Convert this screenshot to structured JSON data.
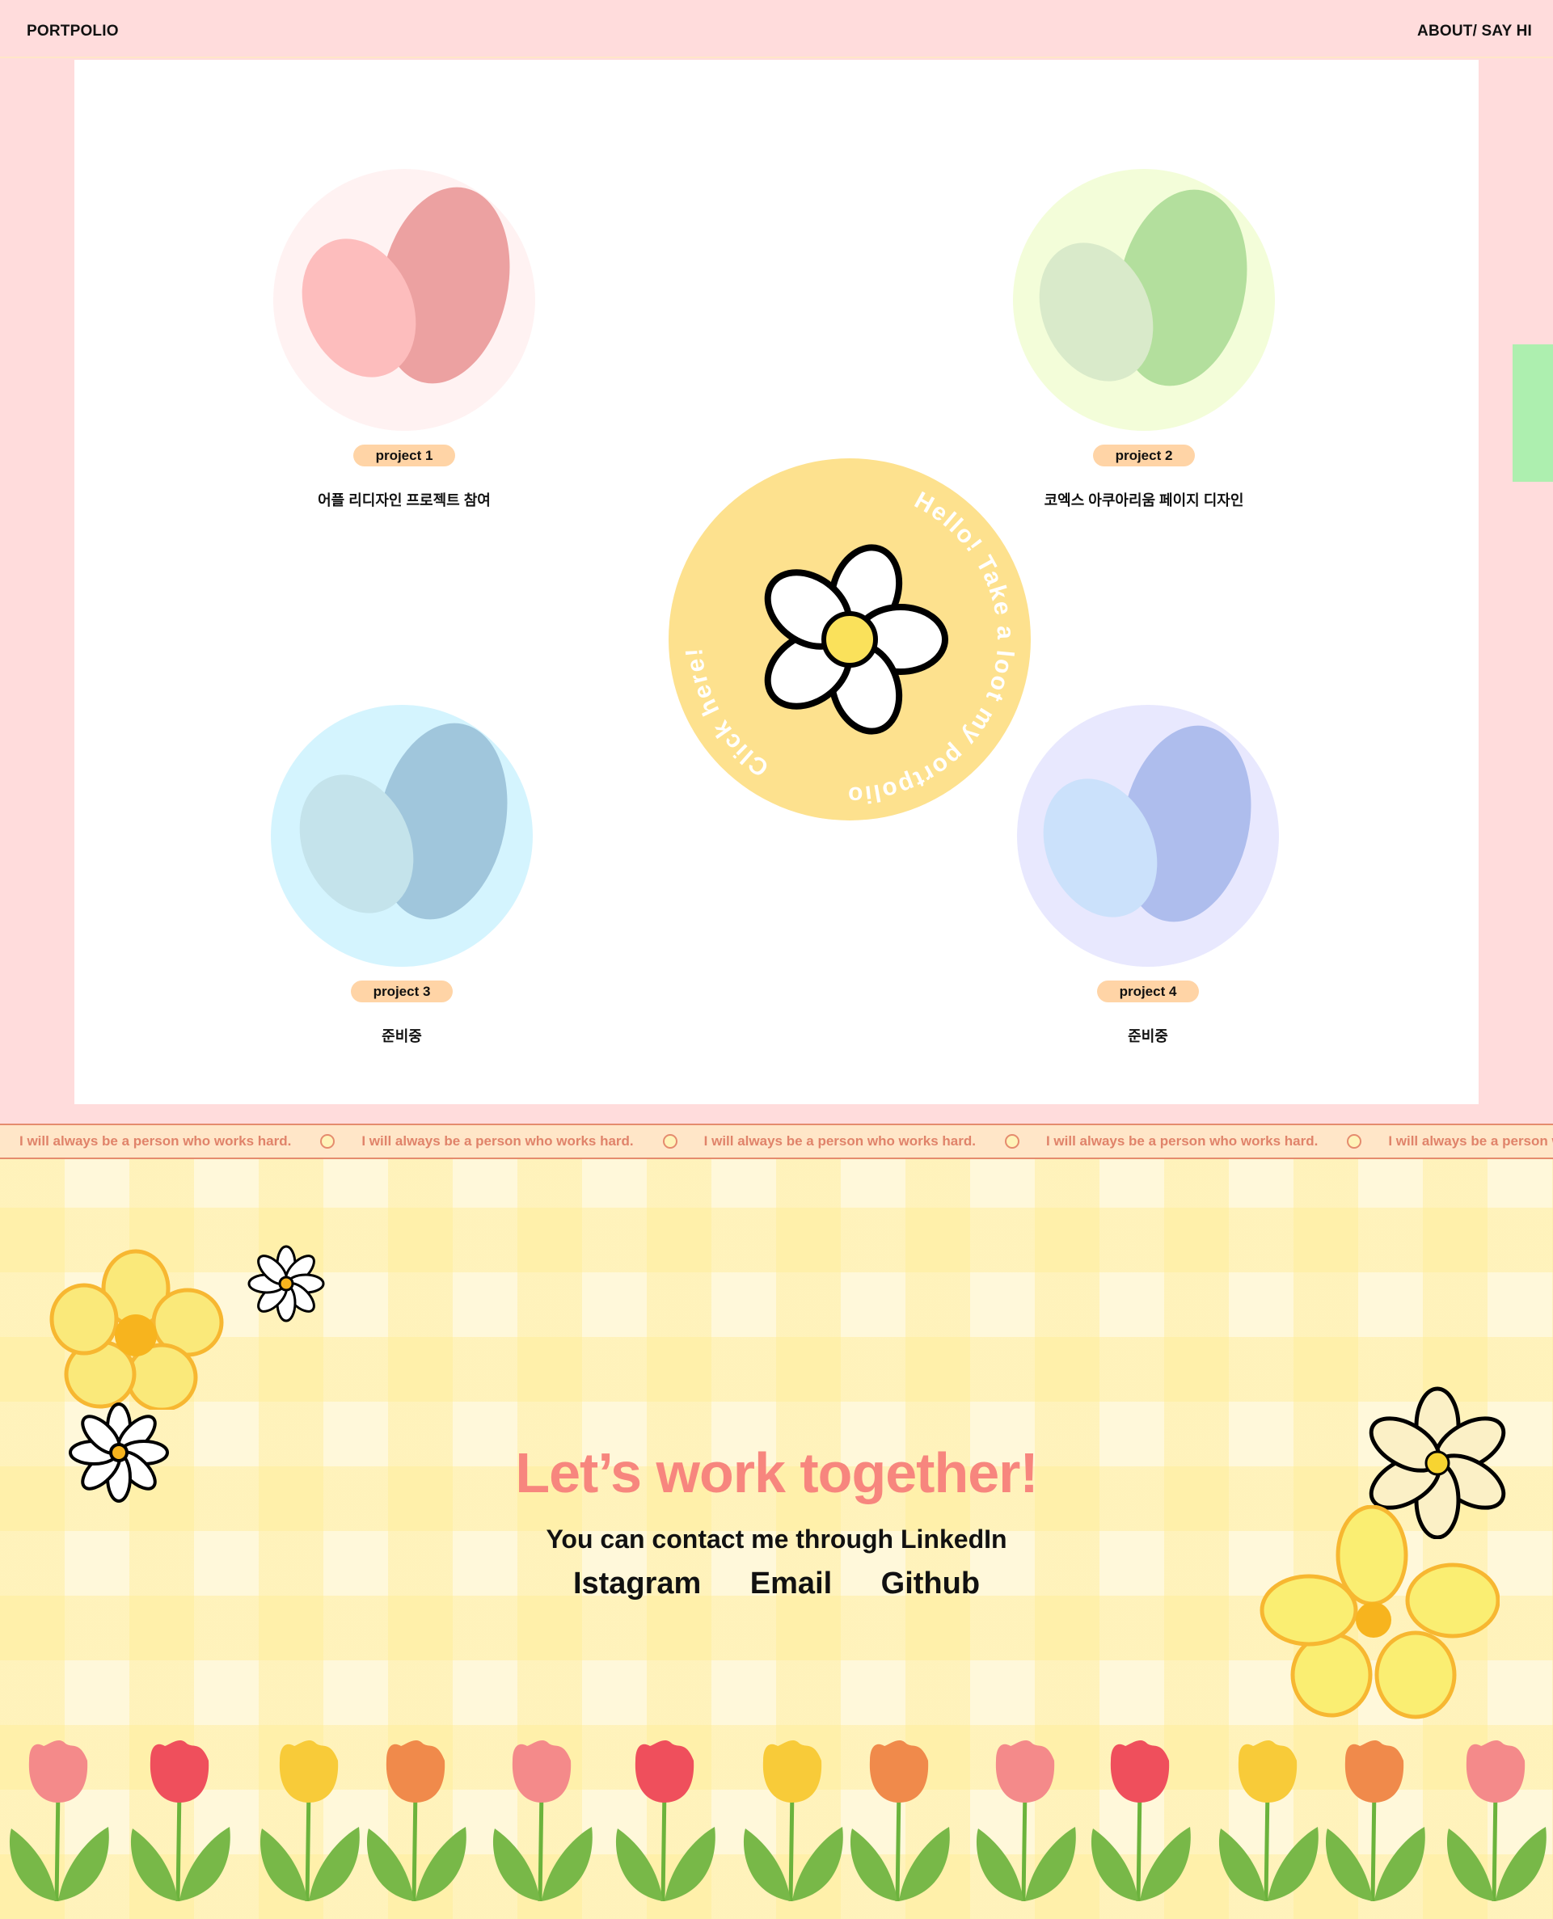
{
  "header": {
    "brand": "PORTPOLIO",
    "nav_right": "ABOUT/ SAY HI"
  },
  "projects": [
    {
      "label": "project 1",
      "desc": "어플 리디자인 프로젝트 참여",
      "colors": {
        "bg": "#FFF2F2",
        "big": "#ECA1A1",
        "small": "#FDBDBD"
      }
    },
    {
      "label": "project 2",
      "desc": "코엑스 아쿠아리움 페이지 디자인",
      "colors": {
        "bg": "#F3FDD9",
        "big": "#B3DF9D",
        "small": "#D9EACA"
      }
    },
    {
      "label": "project 3",
      "desc": "준비중",
      "colors": {
        "bg": "#D4F4FE",
        "big": "#A0C6DC",
        "small": "#C4E3EB"
      }
    },
    {
      "label": "project 4",
      "desc": "준비중",
      "colors": {
        "bg": "#E8E8FE",
        "big": "#AEBDED",
        "small": "#CBE1FB"
      }
    }
  ],
  "center_badge": {
    "text_top": "Hello! Take a loot my portpolio",
    "text_left": "Click here!",
    "bg_color": "#FDE18E"
  },
  "marquee": {
    "items": [
      "I will always be a person who works hard.",
      "I will always be a person who works hard.",
      "I will always be a person who works hard.",
      "I will always be a person who works hard.",
      "I will always be a person who works hard."
    ]
  },
  "contact": {
    "title": "Let’s work together!",
    "subtitle": "You can contact me through LinkedIn",
    "links": [
      "Istagram",
      "Email",
      "Github"
    ]
  },
  "colors": {
    "page_bg": "#FFDCDC",
    "pill": "#FFD4A6",
    "side_tab": "#ADEFAF",
    "accent_title": "#F7867E"
  }
}
